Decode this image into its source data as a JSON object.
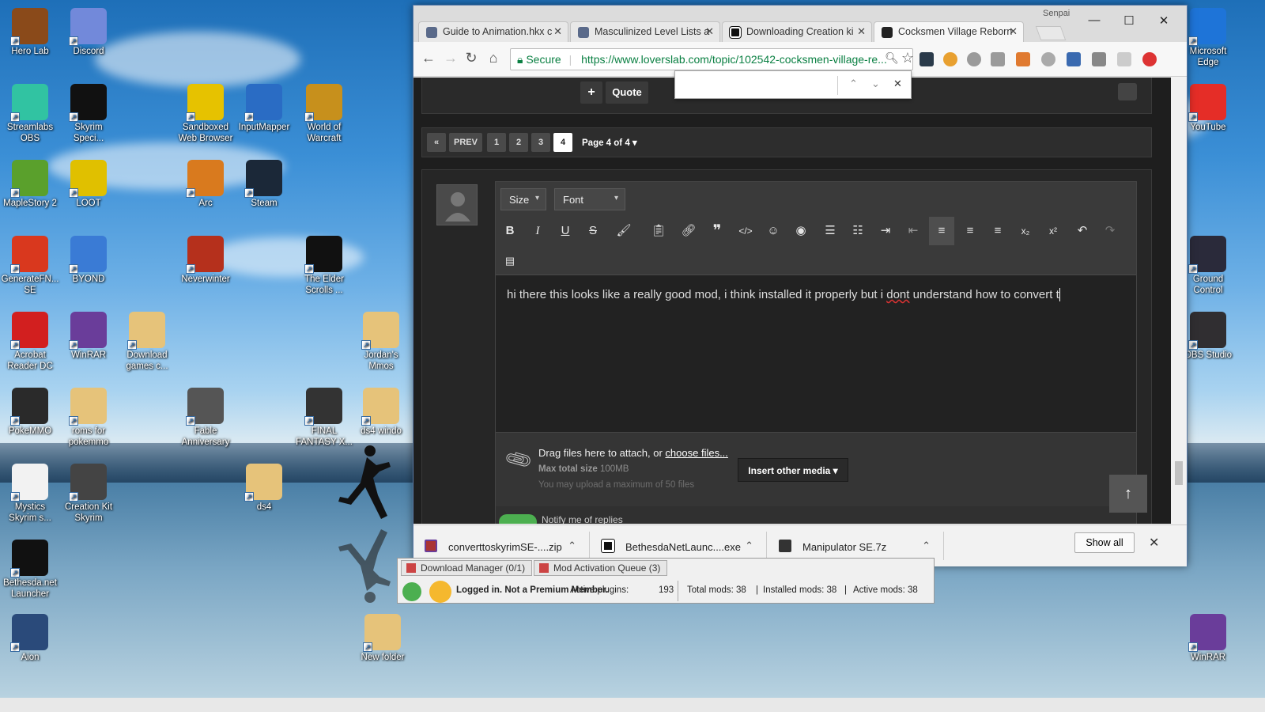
{
  "desktop": {
    "icons": [
      {
        "label": "Hero Lab",
        "color": "#8a4a1a"
      },
      {
        "label": "Discord",
        "color": "#7289da"
      },
      {
        "label": "Streamlabs OBS",
        "color": "#31c3a2"
      },
      {
        "label": "Skyrim Speci...",
        "color": "#111111"
      },
      {
        "label": "Sandboxed Web Browser",
        "color": "#e6c200"
      },
      {
        "label": "InputMapper",
        "color": "#2a6cc4"
      },
      {
        "label": "World of Warcraft",
        "color": "#c7901c"
      },
      {
        "label": "MapleStory 2",
        "color": "#5aa02c"
      },
      {
        "label": "LOOT",
        "color": "#e0c000"
      },
      {
        "label": "Arc",
        "color": "#d97a1e"
      },
      {
        "label": "Steam",
        "color": "#1b2838"
      },
      {
        "label": "GenerateFN... SE",
        "color": "#d9381e"
      },
      {
        "label": "BYOND",
        "color": "#3a7bd5"
      },
      {
        "label": "Neverwinter",
        "color": "#b5301c"
      },
      {
        "label": "The Elder Scrolls ...",
        "color": "#111111"
      },
      {
        "label": "Acrobat Reader DC",
        "color": "#d21f1f"
      },
      {
        "label": "WinRAR",
        "color": "#6a3d9a"
      },
      {
        "label": "Download games c...",
        "color": "#e6c37a"
      },
      {
        "label": "Jordan's Mmos",
        "color": "#e6c37a"
      },
      {
        "label": "PokeMMO",
        "color": "#2a2a2a"
      },
      {
        "label": "roms for pokemmo",
        "color": "#e6c37a"
      },
      {
        "label": "Fable Anniversary",
        "color": "#555555"
      },
      {
        "label": "FINAL FANTASY X...",
        "color": "#333333"
      },
      {
        "label": "ds4 windo",
        "color": "#e6c37a"
      },
      {
        "label": "Mystics Skyrim s...",
        "color": "#f2f2f2"
      },
      {
        "label": "Creation Kit Skyrim",
        "color": "#444444"
      },
      {
        "label": "ds4",
        "color": "#e6c37a"
      },
      {
        "label": "Bethesda.net Launcher",
        "color": "#111111"
      },
      {
        "label": "Aion",
        "color": "#2a4a7a"
      },
      {
        "label": "New folder",
        "color": "#e6c37a"
      },
      {
        "label": "Microsoft Edge",
        "color": "#1e74d8"
      },
      {
        "label": "YouTube",
        "color": "#e52d27"
      },
      {
        "label": "Ground Control",
        "color": "#2a2a3a"
      },
      {
        "label": "OBS Studio",
        "color": "#302e31"
      },
      {
        "label": "WinRAR",
        "color": "#6a3d9a"
      }
    ]
  },
  "browser": {
    "profile_name": "Senpai",
    "tabs": [
      {
        "label": "Guide to Animation.hkx c",
        "active": false
      },
      {
        "label": "Masculinized Level Lists a",
        "active": false
      },
      {
        "label": "Downloading Creation ki",
        "active": false
      },
      {
        "label": "Cocksmen Village Reborn",
        "active": true
      }
    ],
    "window_controls": {
      "minimize": "—",
      "maximize": "☐",
      "close": "✕"
    },
    "omnibox": {
      "secure_label": "Secure",
      "url": "https://www.loverslab.com/topic/102542-cocksmen-village-re..."
    },
    "findbar": {
      "up": "⌃",
      "down": "⌄",
      "close": "✕"
    }
  },
  "page": {
    "post_actions": {
      "plus": "+",
      "quote": "Quote"
    },
    "pager": {
      "first": "«",
      "prev": "PREV",
      "pages": [
        "1",
        "2",
        "3",
        "4"
      ],
      "current": "4",
      "page_of": "Page 4 of 4"
    },
    "editor": {
      "size_label": "Size",
      "font_label": "Font",
      "body_before": "hi there this looks like a really good mod, i think installed it properly but i ",
      "body_misspelled": "dont",
      "body_after": " understand how to convert t"
    },
    "attach": {
      "drag_text": "Drag files here to attach, or ",
      "choose_link": "choose files...",
      "max_label": "Max total size",
      "max_value": "100MB",
      "limit_text": "You may upload a maximum of 50 files",
      "insert_media": "Insert other media"
    },
    "notify": "Notify me of replies"
  },
  "downloads": {
    "items": [
      {
        "name": "converttoskyrimSE-....zip"
      },
      {
        "name": "BethesdaNetLaunc....exe"
      },
      {
        "name": "Manipulator SE.7z"
      }
    ],
    "show_all": "Show all",
    "close": "✕"
  },
  "mod_organizer": {
    "tabs": [
      "Download Manager (0/1)",
      "Mod Activation Queue (3)"
    ],
    "login_status": "Logged in. Not a Premium Member.",
    "active_plugins_label": "Active plugins:",
    "active_plugins": "193",
    "total_mods": "Total mods: 38",
    "installed_mods": "Installed mods: 38",
    "active_mods": "Active mods: 38"
  }
}
